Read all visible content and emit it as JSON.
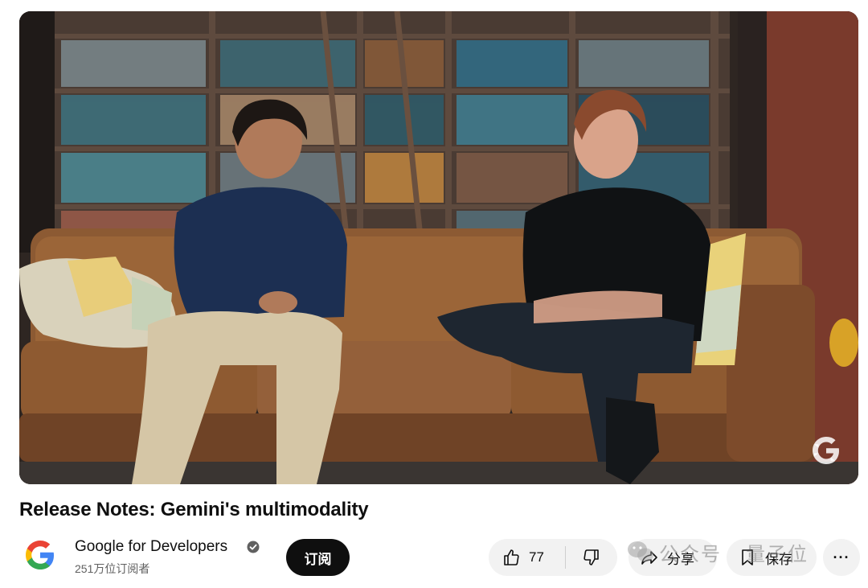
{
  "video": {
    "title": "Release Notes: Gemini's multimodality"
  },
  "channel": {
    "name": "Google for Developers",
    "subscribers": "251万位订阅者",
    "verified": true
  },
  "actions": {
    "subscribe_label": "订阅",
    "like_count": "77",
    "share_label": "分享",
    "save_label": "保存",
    "more_label": "···"
  },
  "watermark": {
    "text_1": "公众号",
    "text_2": "量子位"
  },
  "colors": {
    "subscribe_bg": "#0f0f0f",
    "pill_bg": "#f2f2f2",
    "google_blue": "#4285F4",
    "google_red": "#EA4335",
    "google_yellow": "#FBBC05",
    "google_green": "#34A853"
  },
  "icons": [
    "google-g-icon",
    "verified-check-icon",
    "thumbs-up-icon",
    "thumbs-down-icon",
    "share-arrow-icon",
    "bookmark-icon",
    "more-dots-icon",
    "wechat-icon"
  ]
}
